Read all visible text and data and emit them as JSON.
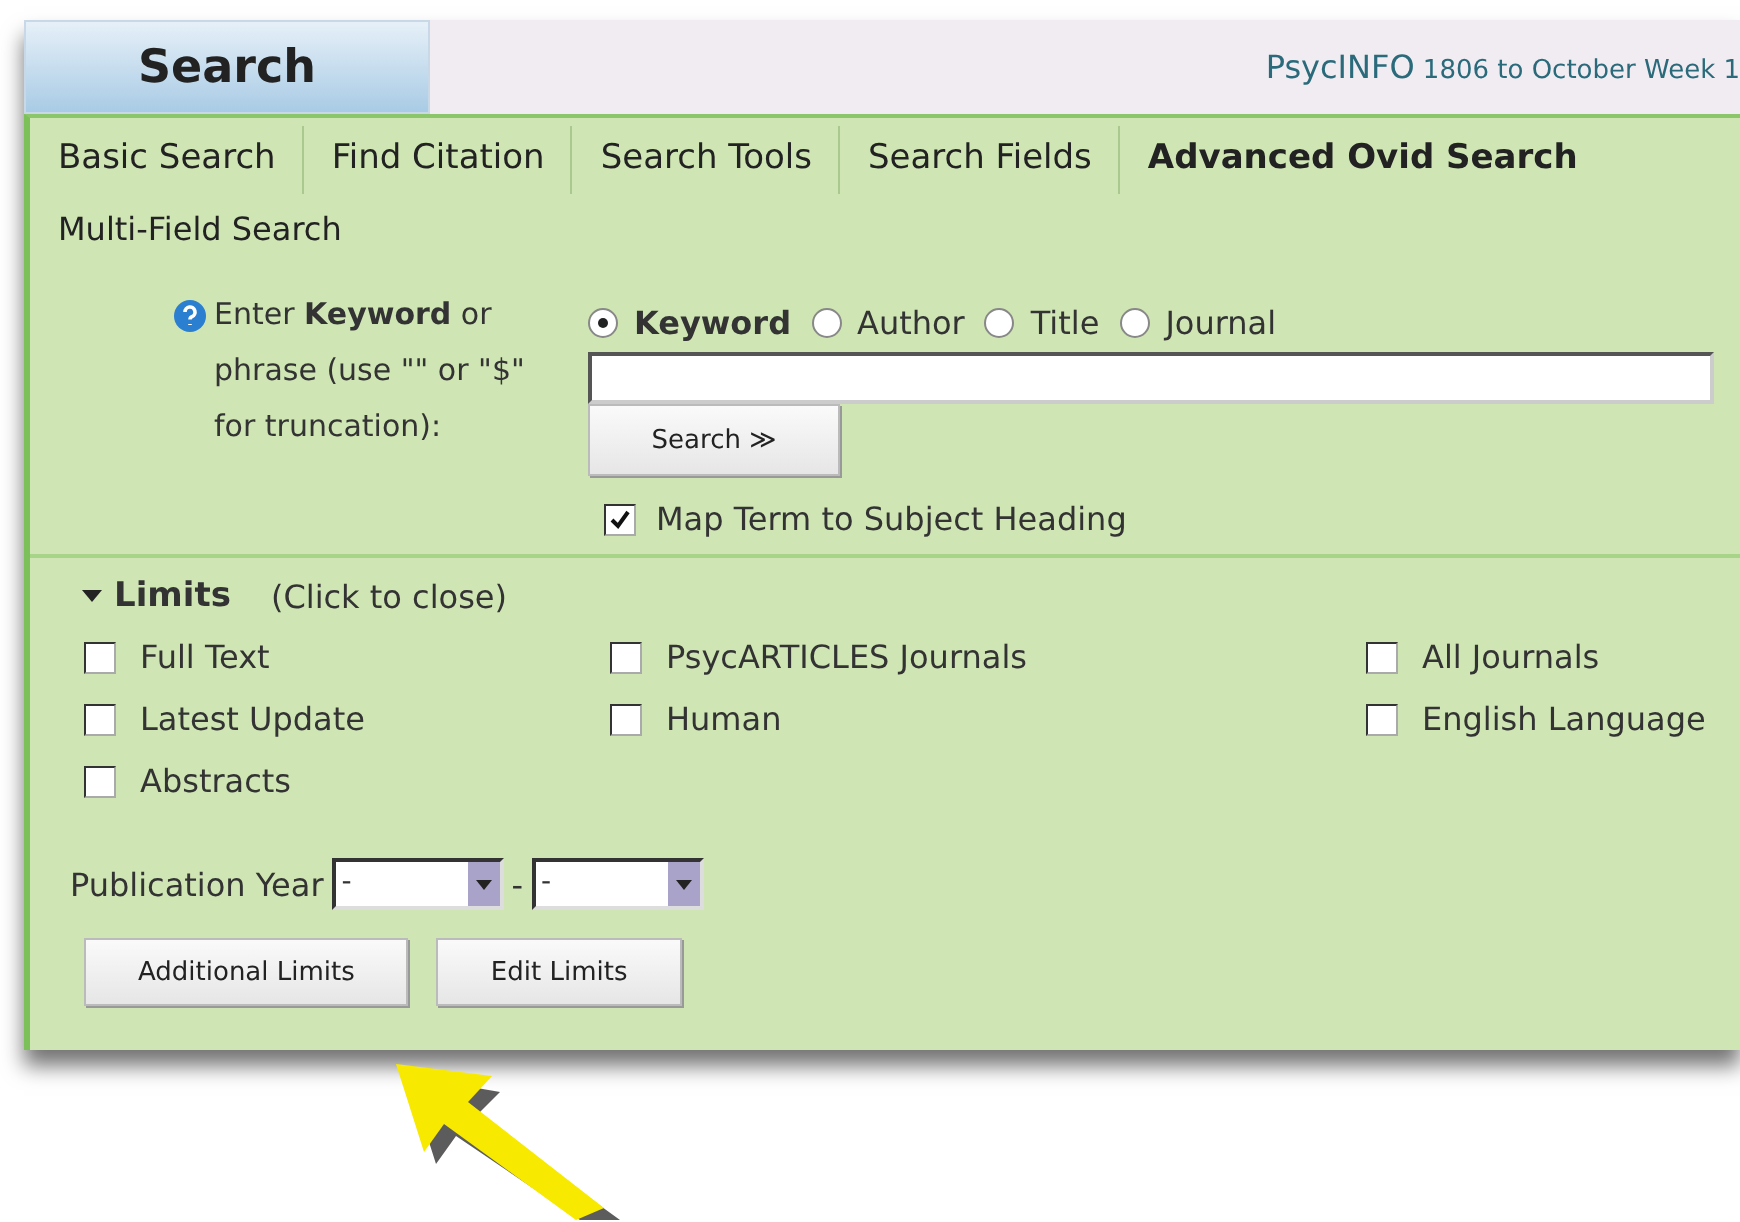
{
  "header": {
    "title": "Search",
    "database": "PsycINFO",
    "coverage": "1806 to October Week 1"
  },
  "tabs": [
    {
      "label": "Basic Search",
      "selected": false
    },
    {
      "label": "Find Citation",
      "selected": false
    },
    {
      "label": "Search Tools",
      "selected": false
    },
    {
      "label": "Search Fields",
      "selected": false
    },
    {
      "label": "Advanced Ovid Search",
      "selected": true
    }
  ],
  "subtab": "Multi-Field Search",
  "search": {
    "help_label": "Enter **Keyword** or phrase (use \"\" or \"$\" for truncation):",
    "fields": [
      {
        "label": "Keyword",
        "selected": true
      },
      {
        "label": "Author",
        "selected": false
      },
      {
        "label": "Title",
        "selected": false
      },
      {
        "label": "Journal",
        "selected": false
      }
    ],
    "button": "Search ≫",
    "map_term": {
      "label": "Map Term to Subject Heading",
      "checked": true
    }
  },
  "limits": {
    "title": "Limits",
    "hint": "(Click to close)",
    "expanded": true,
    "columns": [
      [
        {
          "label": "Full Text",
          "checked": false
        },
        {
          "label": "Latest Update",
          "checked": false
        },
        {
          "label": "Abstracts",
          "checked": false
        }
      ],
      [
        {
          "label": "PsycARTICLES Journals",
          "checked": false
        },
        {
          "label": "Human",
          "checked": false
        }
      ],
      [
        {
          "label": "All Journals",
          "checked": false
        },
        {
          "label": "English Language",
          "checked": false
        }
      ]
    ],
    "publication_year": {
      "label": "Publication Year",
      "from": "-",
      "separator": "-",
      "to": "-"
    },
    "buttons": [
      "Additional Limits",
      "Edit Limits"
    ]
  }
}
